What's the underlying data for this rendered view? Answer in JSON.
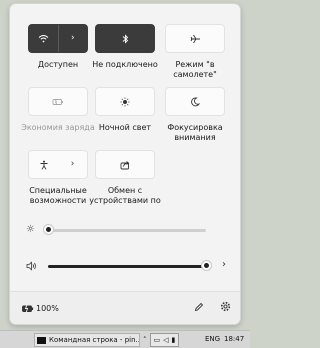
{
  "quick_settings": {
    "tiles": [
      {
        "label": "Доступен",
        "icon": "wifi-icon",
        "state": "on",
        "split": true,
        "dim": false
      },
      {
        "label": "Не подключено",
        "icon": "bluetooth-icon",
        "state": "on",
        "split": false,
        "dim": false
      },
      {
        "label": "Режим \"в самолете\"",
        "icon": "airplane-icon",
        "state": "off",
        "split": false,
        "dim": false
      },
      {
        "label": "Экономия заряда",
        "icon": "battery-saver-icon",
        "state": "off",
        "split": false,
        "dim": true
      },
      {
        "label": "Ночной свет",
        "icon": "night-light-icon",
        "state": "off",
        "split": false,
        "dim": false
      },
      {
        "label": "Фокусировка внимания",
        "icon": "focus-moon-icon",
        "state": "off",
        "split": false,
        "dim": false
      },
      {
        "label": "Специальные возможности",
        "icon": "accessibility-icon",
        "state": "off",
        "split": true,
        "dim": false
      },
      {
        "label": "Обмен с устройствами по",
        "icon": "share-icon",
        "state": "off",
        "split": false,
        "dim": false
      }
    ],
    "brightness": {
      "icon": "brightness-icon",
      "value": 0.0
    },
    "volume": {
      "icon": "speaker-icon",
      "value": 1.0,
      "extra_icon": "chevron-right-icon"
    },
    "battery": {
      "icon": "battery-charging-icon",
      "percent": "100%"
    },
    "edit_icon": "pencil-icon",
    "settings_icon": "gear-icon"
  },
  "taskbar": {
    "task_label": "Командная строка - pin...",
    "language": "ENG",
    "time": "18:47",
    "tray_icons": [
      "network-icon",
      "speaker-icon",
      "battery-icon"
    ]
  },
  "colors": {
    "tile_on": "#3b3b3b",
    "panel_bg": "#f3f3f3",
    "desktop_bg": "#cdd3c9"
  }
}
